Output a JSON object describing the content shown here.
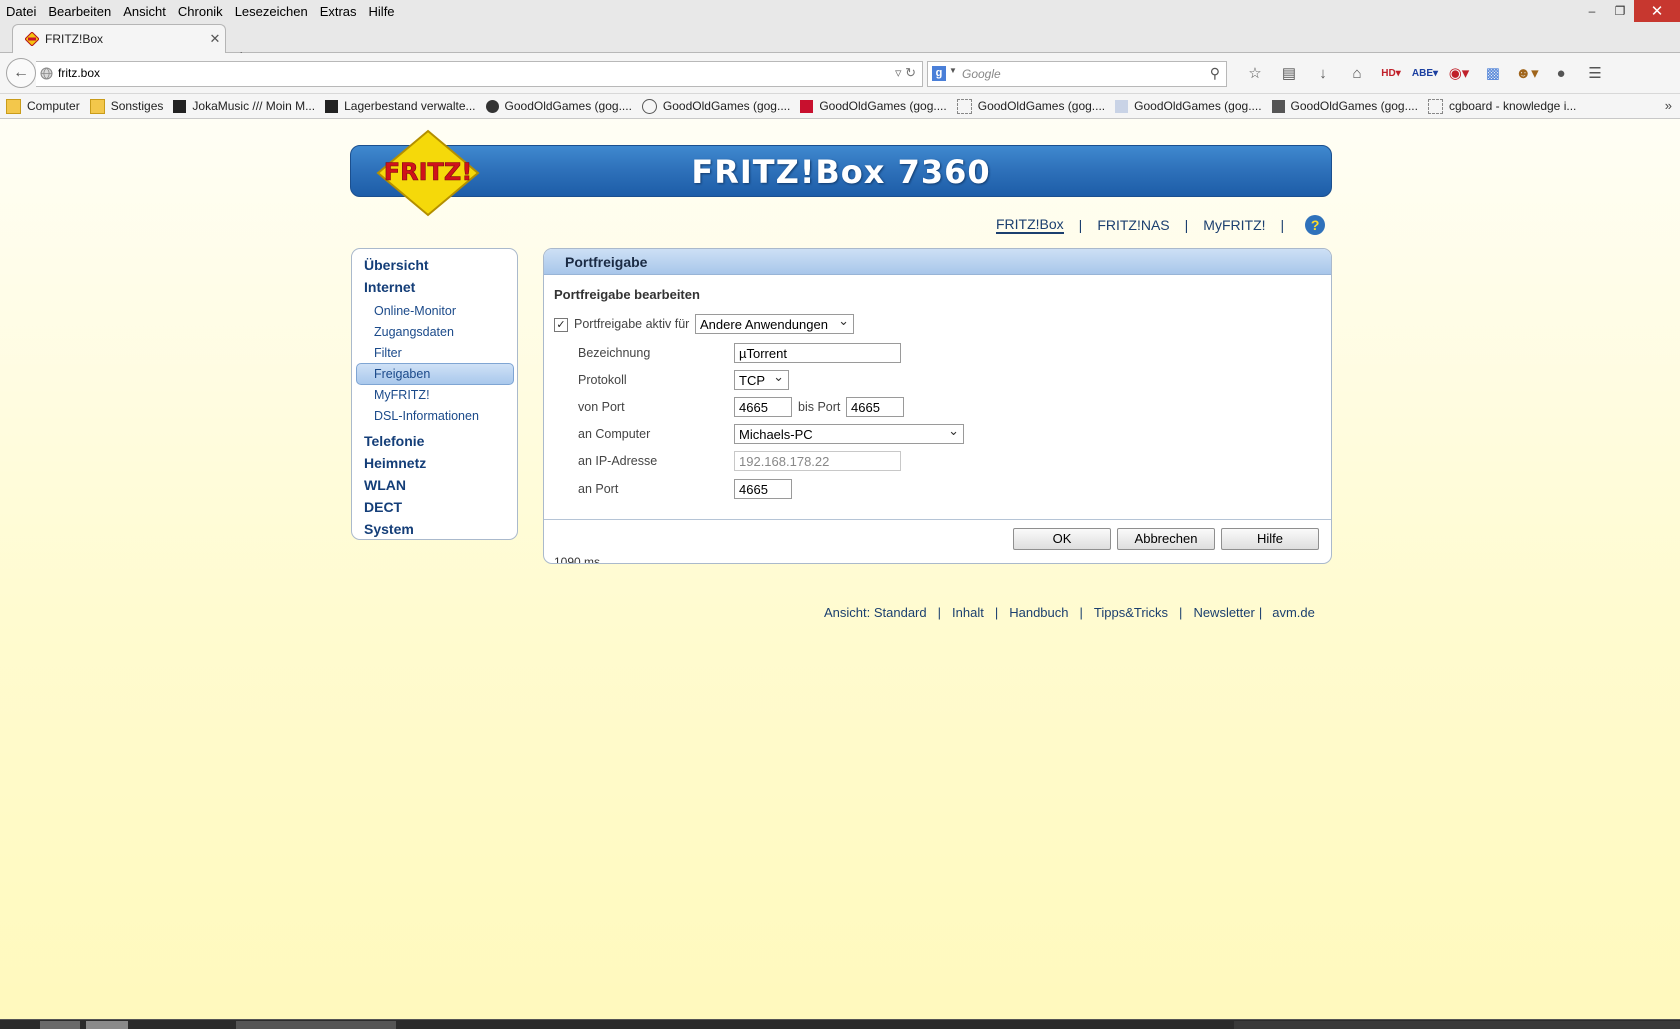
{
  "browser": {
    "menu": [
      "Datei",
      "Bearbeiten",
      "Ansicht",
      "Chronik",
      "Lesezeichen",
      "Extras",
      "Hilfe"
    ],
    "tab_title": "FRITZ!Box",
    "url": "fritz.box",
    "search_placeholder": "Google",
    "bookmarks": [
      {
        "label": "Computer",
        "icon": "folder-icon"
      },
      {
        "label": "Sonstiges",
        "icon": "folder-icon"
      },
      {
        "label": "JokaMusic /// Moin M...",
        "icon": "jokamusic-icon"
      },
      {
        "label": "Lagerbestand verwalte...",
        "icon": "amazon-icon"
      },
      {
        "label": "GoodOldGames (gog....",
        "icon": "gog-icon"
      },
      {
        "label": "GoodOldGames (gog....",
        "icon": "gog-icon"
      },
      {
        "label": "GoodOldGames (gog....",
        "icon": "gog-icon"
      },
      {
        "label": "GoodOldGames (gog....",
        "icon": "gog-icon"
      },
      {
        "label": "GoodOldGames (gog....",
        "icon": "gog-icon"
      },
      {
        "label": "GoodOldGames (gog....",
        "icon": "gog-icon"
      },
      {
        "label": "cgboard - knowledge i...",
        "icon": "page-icon"
      }
    ]
  },
  "fritz": {
    "logo_text": "FRITZ!",
    "banner_title": "FRITZ!Box 7360",
    "toplinks": [
      "FRITZ!Box",
      "FRITZ!NAS",
      "MyFRITZ!"
    ],
    "nav": {
      "main_before": [
        "Übersicht",
        "Internet"
      ],
      "sub": [
        "Online-Monitor",
        "Zugangsdaten",
        "Filter",
        "Freigaben",
        "MyFRITZ!",
        "DSL-Informationen"
      ],
      "selected_sub": "Freigaben",
      "main_after": [
        "Telefonie",
        "Heimnetz",
        "WLAN",
        "DECT",
        "System"
      ]
    },
    "panel": {
      "title": "Portfreigabe",
      "subtitle": "Portfreigabe bearbeiten",
      "active_label": "Portfreigabe aktiv für",
      "active_checked": true,
      "active_value": "Andere Anwendungen",
      "fields": {
        "bezeichnung_label": "Bezeichnung",
        "bezeichnung_value": "µTorrent",
        "protokoll_label": "Protokoll",
        "protokoll_value": "TCP",
        "von_port_label": "von Port",
        "von_port_value": "4665",
        "bis_port_label": "bis Port",
        "bis_port_value": "4665",
        "computer_label": "an Computer",
        "computer_value": "Michaels-PC",
        "ip_label": "an IP-Adresse",
        "ip_value": "192.168.178.22",
        "an_port_label": "an Port",
        "an_port_value": "4665"
      },
      "buttons": {
        "ok": "OK",
        "cancel": "Abbrechen",
        "help": "Hilfe"
      },
      "timing": "1090 ms"
    },
    "footer": [
      "Ansicht: Standard",
      "Inhalt",
      "Handbuch",
      "Tipps&Tricks",
      "Newsletter",
      "avm.de"
    ]
  }
}
